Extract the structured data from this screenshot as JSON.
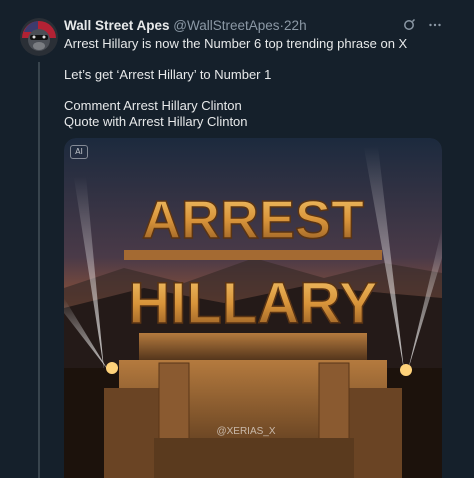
{
  "tweet": {
    "author_name": "Wall Street Apes",
    "handle": "@WallStreetApes",
    "separator": "·",
    "time": "22h",
    "lines": [
      "Arrest Hillary is now the Number 6 top trending phrase on X",
      "Let’s get ‘Arrest Hillary’ to Number 1",
      "Comment Arrest Hillary Clinton",
      "Quote with Arrest Hillary Clinton"
    ]
  },
  "media": {
    "ai_badge": "AI",
    "headline_top": "ARREST",
    "headline_bottom": "HILLARY",
    "watermark": "@XERIAS_X"
  },
  "icons": {
    "avatar": "ape-avatar-icon",
    "refresh": "grok-icon",
    "more": "more-icon"
  }
}
